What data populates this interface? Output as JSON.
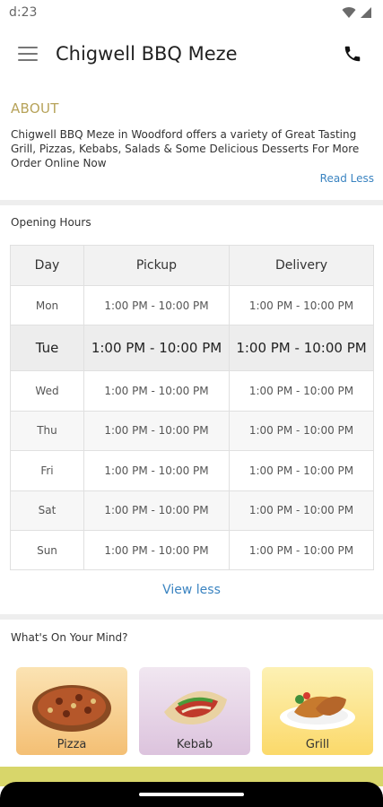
{
  "status_bar": {
    "time": "d:23",
    "icons": [
      "wifi-icon",
      "signal-icon"
    ]
  },
  "app_bar": {
    "title": "Chigwell BBQ Meze",
    "menu_icon": "hamburger-menu-icon",
    "call_icon": "phone-icon"
  },
  "about": {
    "heading": "ABOUT",
    "text": "Chigwell BBQ Meze in Woodford offers a variety of Great Tasting Grill, Pizzas, Kebabs, Salads & Some Delicious Desserts For More Order Online Now",
    "toggle_label": "Read Less"
  },
  "opening_hours": {
    "heading": "Opening Hours",
    "columns": [
      "Day",
      "Pickup",
      "Delivery"
    ],
    "rows": [
      {
        "day": "Mon",
        "pickup": "1:00 PM - 10:00 PM",
        "delivery": "1:00 PM - 10:00 PM"
      },
      {
        "day": "Tue",
        "pickup": "1:00 PM - 10:00 PM",
        "delivery": "1:00 PM - 10:00 PM"
      },
      {
        "day": "Wed",
        "pickup": "1:00 PM - 10:00 PM",
        "delivery": "1:00 PM - 10:00 PM"
      },
      {
        "day": "Thu",
        "pickup": "1:00 PM - 10:00 PM",
        "delivery": "1:00 PM - 10:00 PM"
      },
      {
        "day": "Fri",
        "pickup": "1:00 PM - 10:00 PM",
        "delivery": "1:00 PM - 10:00 PM"
      },
      {
        "day": "Sat",
        "pickup": "1:00 PM - 10:00 PM",
        "delivery": "1:00 PM - 10:00 PM"
      },
      {
        "day": "Sun",
        "pickup": "1:00 PM - 10:00 PM",
        "delivery": "1:00 PM - 10:00 PM"
      }
    ],
    "toggle_label": "View less"
  },
  "categories": {
    "heading": "What's On Your Mind?",
    "items": [
      {
        "label": "Pizza",
        "icon": "pizza-icon"
      },
      {
        "label": "Kebab",
        "icon": "kebab-icon"
      },
      {
        "label": "Grill",
        "icon": "grill-icon"
      }
    ]
  },
  "colors": {
    "about_heading": "#b7a35a",
    "link": "#3b84c1",
    "bottom_strip": "#d8d66a"
  }
}
